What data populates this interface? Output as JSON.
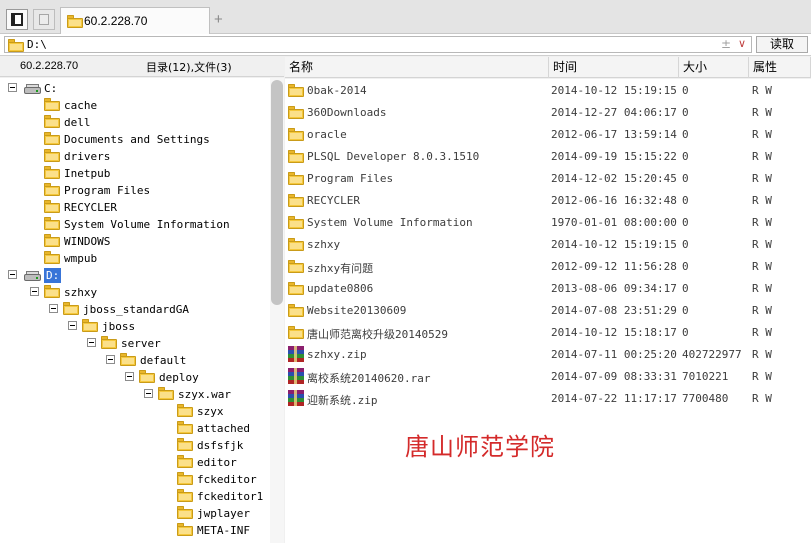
{
  "tabs": [
    {
      "label": "60.2.228.70"
    }
  ],
  "toolbar": {
    "new_tab": "+"
  },
  "address": {
    "path": "D:\\",
    "star": "±",
    "dropdown": "∨"
  },
  "read_button": "读取",
  "left_header": {
    "host": "60.2.228.70",
    "counts": "目录(12),文件(3)"
  },
  "tree": [
    {
      "label": "C:",
      "type": "drive",
      "depth": 0,
      "expanded": true
    },
    {
      "label": "cache",
      "type": "folder",
      "depth": 1
    },
    {
      "label": "dell",
      "type": "folder",
      "depth": 1
    },
    {
      "label": "Documents and Settings",
      "type": "folder",
      "depth": 1
    },
    {
      "label": "drivers",
      "type": "folder",
      "depth": 1
    },
    {
      "label": "Inetpub",
      "type": "folder",
      "depth": 1
    },
    {
      "label": "Program Files",
      "type": "folder",
      "depth": 1
    },
    {
      "label": "RECYCLER",
      "type": "folder",
      "depth": 1
    },
    {
      "label": "System Volume Information",
      "type": "folder",
      "depth": 1
    },
    {
      "label": "WINDOWS",
      "type": "folder",
      "depth": 1
    },
    {
      "label": "wmpub",
      "type": "folder",
      "depth": 1
    },
    {
      "label": "D:",
      "type": "drive",
      "depth": 0,
      "expanded": true,
      "selected": true
    },
    {
      "label": "szhxy",
      "type": "folder",
      "depth": 1,
      "expanded": true
    },
    {
      "label": "jboss_standardGA",
      "type": "folder",
      "depth": 2,
      "expanded": true
    },
    {
      "label": "jboss",
      "type": "folder",
      "depth": 3,
      "expanded": true
    },
    {
      "label": "server",
      "type": "folder",
      "depth": 4,
      "expanded": true
    },
    {
      "label": "default",
      "type": "folder",
      "depth": 5,
      "expanded": true
    },
    {
      "label": "deploy",
      "type": "folder",
      "depth": 6,
      "expanded": true
    },
    {
      "label": "szyx.war",
      "type": "folder",
      "depth": 7,
      "expanded": true
    },
    {
      "label": "szyx",
      "type": "folder",
      "depth": 8
    },
    {
      "label": "attached",
      "type": "folder",
      "depth": 8
    },
    {
      "label": "dsfsfjk",
      "type": "folder",
      "depth": 8
    },
    {
      "label": "editor",
      "type": "folder",
      "depth": 8
    },
    {
      "label": "fckeditor",
      "type": "folder",
      "depth": 8
    },
    {
      "label": "fckeditor1",
      "type": "folder",
      "depth": 8
    },
    {
      "label": "jwplayer",
      "type": "folder",
      "depth": 8
    },
    {
      "label": "META-INF",
      "type": "folder",
      "depth": 8
    }
  ],
  "columns": {
    "name": "名称",
    "time": "时间",
    "size": "大小",
    "attr": "属性"
  },
  "files": [
    {
      "name": "0bak-2014",
      "time": "2014-10-12 15:19:15",
      "size": "0",
      "attr": "R W",
      "type": "folder"
    },
    {
      "name": "360Downloads",
      "time": "2014-12-27 04:06:17",
      "size": "0",
      "attr": "R W",
      "type": "folder"
    },
    {
      "name": "oracle",
      "time": "2012-06-17 13:59:14",
      "size": "0",
      "attr": "R W",
      "type": "folder"
    },
    {
      "name": "PLSQL Developer 8.0.3.1510",
      "time": "2014-09-19 15:15:22",
      "size": "0",
      "attr": "R W",
      "type": "folder"
    },
    {
      "name": "Program Files",
      "time": "2014-12-02 15:20:45",
      "size": "0",
      "attr": "R W",
      "type": "folder"
    },
    {
      "name": "RECYCLER",
      "time": "2012-06-16 16:32:48",
      "size": "0",
      "attr": "R W",
      "type": "folder"
    },
    {
      "name": "System Volume Information",
      "time": "1970-01-01 08:00:00",
      "size": "0",
      "attr": "R W",
      "type": "folder"
    },
    {
      "name": "szhxy",
      "time": "2014-10-12 15:19:15",
      "size": "0",
      "attr": "R W",
      "type": "folder"
    },
    {
      "name": "szhxy有问题",
      "time": "2012-09-12 11:56:28",
      "size": "0",
      "attr": "R W",
      "type": "folder"
    },
    {
      "name": "update0806",
      "time": "2013-08-06 09:34:17",
      "size": "0",
      "attr": "R W",
      "type": "folder"
    },
    {
      "name": "Website20130609",
      "time": "2014-07-08 23:51:29",
      "size": "0",
      "attr": "R W",
      "type": "folder"
    },
    {
      "name": "唐山师范离校升级20140529",
      "time": "2014-10-12 15:18:17",
      "size": "0",
      "attr": "R W",
      "type": "folder"
    },
    {
      "name": "szhxy.zip",
      "time": "2014-07-11 00:25:20",
      "size": "402722977",
      "attr": "R W",
      "type": "archive"
    },
    {
      "name": "离校系统20140620.rar",
      "time": "2014-07-09 08:33:31",
      "size": "7010221",
      "attr": "R W",
      "type": "archive"
    },
    {
      "name": "迎新系统.zip",
      "time": "2014-07-22 11:17:17",
      "size": "7700480",
      "attr": "R W",
      "type": "archive"
    }
  ],
  "watermark": "唐山师范学院"
}
